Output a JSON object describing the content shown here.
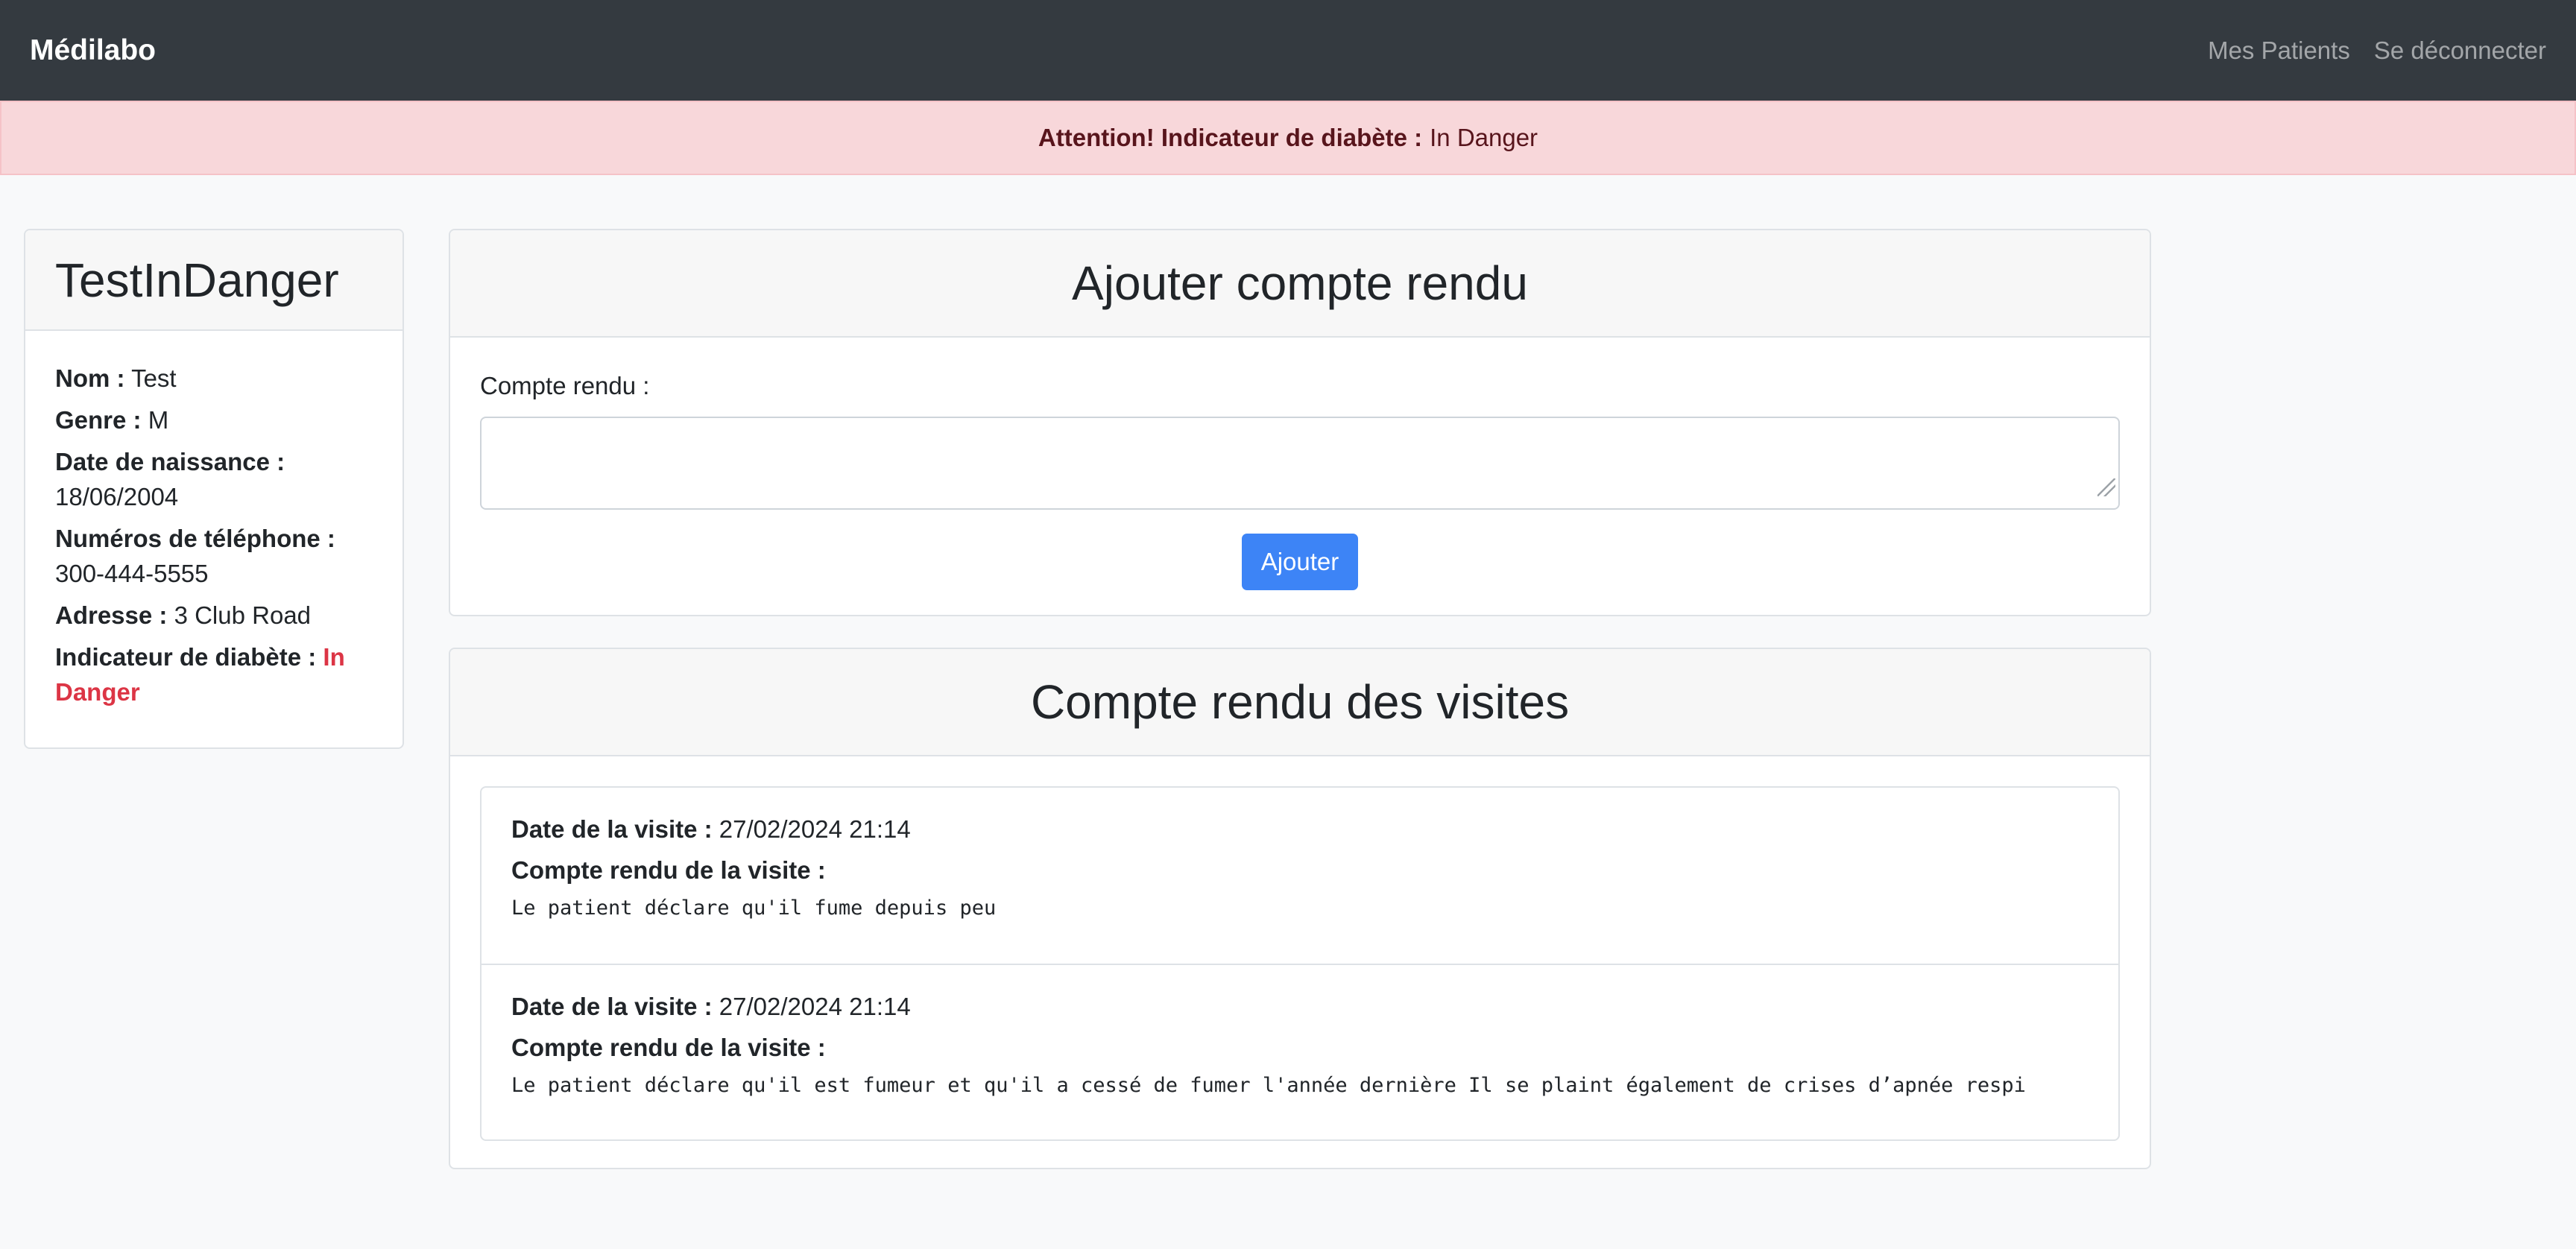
{
  "navbar": {
    "brand": "Médilabo",
    "links": [
      "Mes Patients",
      "Se déconnecter"
    ]
  },
  "alert": {
    "label": "Attention! Indicateur de diabète :",
    "value": "In Danger"
  },
  "patient": {
    "title": "TestInDanger",
    "nom_label": "Nom :",
    "nom": "Test",
    "genre_label": "Genre :",
    "genre": "M",
    "dob_label": "Date de naissance :",
    "dob": "18/06/2004",
    "phone_label": "Numéros de téléphone :",
    "phone": "300-444-5555",
    "address_label": "Adresse :",
    "address": "3 Club Road",
    "indicator_label": "Indicateur de diabète :",
    "indicator": "In Danger"
  },
  "add_note": {
    "title": "Ajouter compte rendu",
    "field_label": "Compte rendu :",
    "field_value": "",
    "button": "Ajouter"
  },
  "visits": {
    "title": "Compte rendu des visites",
    "date_label": "Date de la visite :",
    "note_label": "Compte rendu de la visite :",
    "items": [
      {
        "date": "27/02/2024 21:14",
        "note": "Le patient déclare qu'il fume depuis peu"
      },
      {
        "date": "27/02/2024 21:14",
        "note": "Le patient déclare qu'il est fumeur et qu'il a cessé de fumer l'année dernière Il se plaint également de crises d’apnée respi"
      }
    ]
  },
  "colors": {
    "navbar_bg": "#343a40",
    "alert_bg": "#f8d7da",
    "alert_text": "#58151c",
    "danger": "#dc3545",
    "primary": "#3d84f6"
  }
}
